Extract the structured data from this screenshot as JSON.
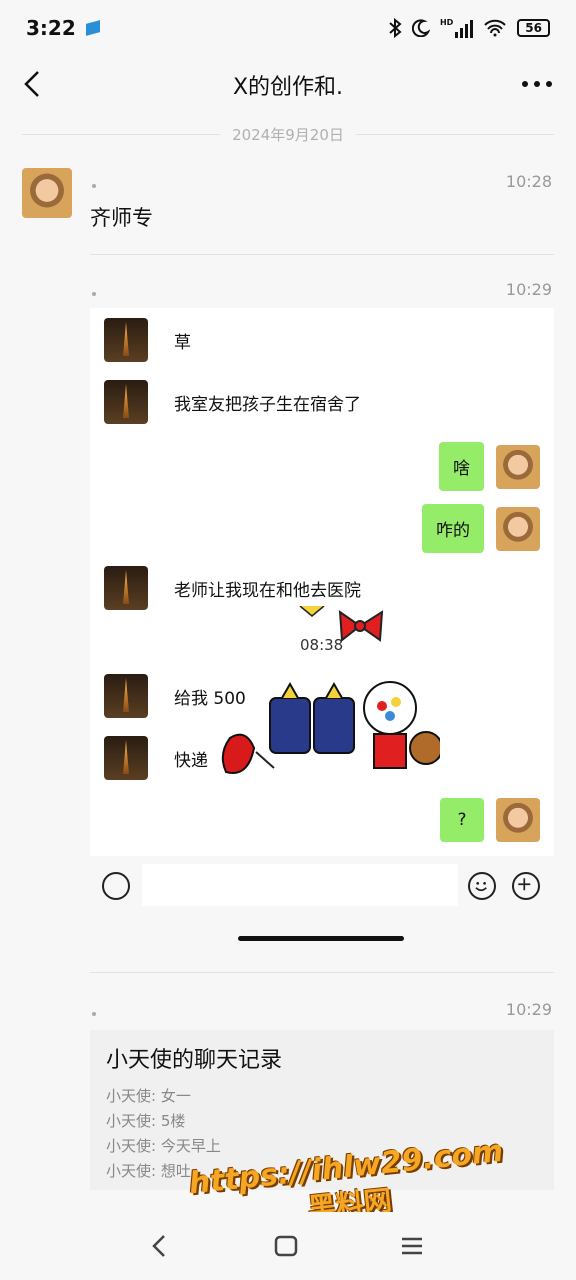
{
  "status_bar": {
    "time": "3:22",
    "battery": "56",
    "network": "HD"
  },
  "header": {
    "title": "X的创作和."
  },
  "date_divider": "2024年9月20日",
  "messages": [
    {
      "time": "10:28",
      "text": "齐师专"
    },
    {
      "time": "10:29"
    },
    {
      "time": "10:29"
    }
  ],
  "chat_card": {
    "incoming": [
      {
        "text": "草"
      },
      {
        "text": "我室友把孩子生在宿舍了"
      },
      {
        "text": "老师让我现在和他去医院"
      },
      {
        "text": "给我 500"
      },
      {
        "text": "快递"
      }
    ],
    "outgoing": [
      {
        "text": "啥"
      },
      {
        "text": "咋的"
      },
      {
        "text": "?"
      }
    ],
    "inner_time": "08:38"
  },
  "forward_card": {
    "title": "小天使的聊天记录",
    "lines": [
      "小天使: 女一",
      "小天使: 5楼",
      "小天使: 今天早上",
      "小天使: 想吐"
    ]
  },
  "watermark": {
    "url": "https://ihlw29.com",
    "brand": "黑料网"
  },
  "colors": {
    "bubble_green": "#95ec69",
    "watermark_orange": "#f5a623"
  }
}
